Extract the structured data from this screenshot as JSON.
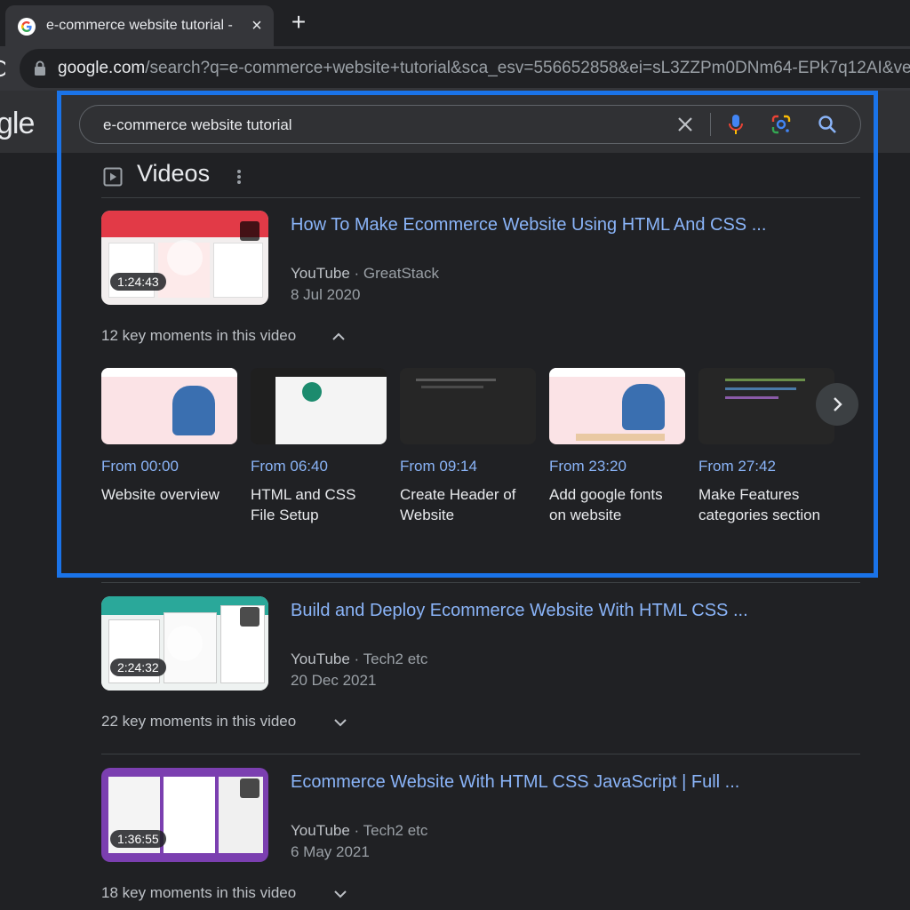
{
  "browser": {
    "tab_title": "e-commerce website tutorial -",
    "new_tab_glyph": "+",
    "close_glyph": "×",
    "url_host": "google.com",
    "url_rest": "/search?q=e-commerce+website+tutorial&sca_esv=556652858&ei=sL3ZZPm0DNm64-EPk7q12AI&ve"
  },
  "page": {
    "logo_fragment": "gle",
    "search_query": "e-commerce website tutorial",
    "section_title": "Videos"
  },
  "videos": [
    {
      "title": "How To Make Ecommerce Website Using HTML And CSS ...",
      "source": "YouTube",
      "channel": "GreatStack",
      "date": "8 Jul 2020",
      "duration": "1:24:43",
      "key_moments": "12 key moments in this video",
      "expanded": true,
      "thumb_color": "#e23a47"
    },
    {
      "title": "Build and Deploy Ecommerce Website With HTML CSS ...",
      "source": "YouTube",
      "channel": "Tech2 etc",
      "date": "20 Dec 2021",
      "duration": "2:24:32",
      "key_moments": "22 key moments in this video",
      "expanded": false,
      "thumb_color": "#2aa89a"
    },
    {
      "title": "Ecommerce Website With HTML CSS JavaScript | Full ...",
      "source": "YouTube",
      "channel": "Tech2 etc",
      "date": "6 May 2021",
      "duration": "1:36:55",
      "key_moments": "18 key moments in this video",
      "expanded": false,
      "thumb_color": "#7b3fb0"
    }
  ],
  "moments": [
    {
      "time": "From 00:00",
      "label": "Website overview",
      "style": "pink"
    },
    {
      "time": "From 06:40",
      "label": "HTML and CSS File Setup",
      "style": "browser"
    },
    {
      "time": "From 09:14",
      "label": "Create Header of Website",
      "style": "code"
    },
    {
      "time": "From 23:20",
      "label": "Add google fonts on website",
      "style": "pink"
    },
    {
      "time": "From 27:42",
      "label": "Make Features categories section",
      "style": "code"
    }
  ],
  "colors": {
    "link": "#8ab4f8",
    "highlight": "#1a73e8",
    "background": "#202124"
  }
}
